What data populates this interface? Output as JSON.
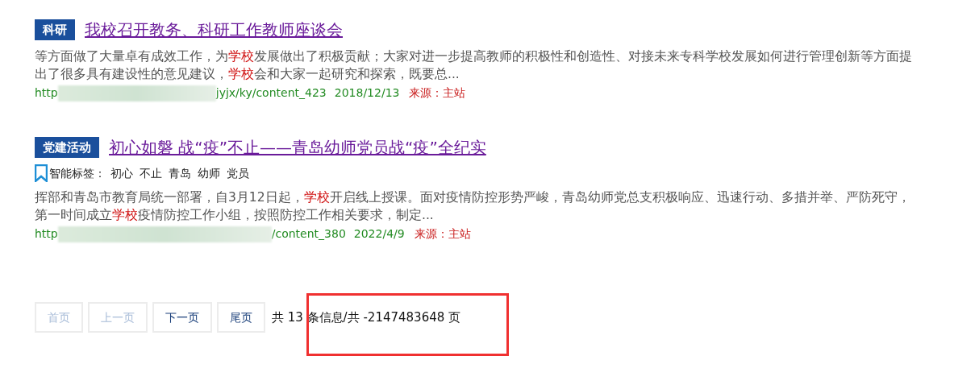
{
  "results": [
    {
      "category": "科研",
      "title": "我校召开教务、科研工作教师座谈会",
      "snippet": [
        {
          "text": "等方面做了大量卓有成效工作，为",
          "highlight": false
        },
        {
          "text": "学校",
          "highlight": true
        },
        {
          "text": "发展做出了积极贡献；大家对进一步提高教师的积极性和创造性、对接未来专科学校发展如何进行管理创新等方面提出了很多具有建设性的意见建议，",
          "highlight": false
        },
        {
          "text": "学校",
          "highlight": true
        },
        {
          "text": "会和大家一起研究和探索，既要总...",
          "highlight": false
        }
      ],
      "url_start": "http",
      "url_end": "jyjx/ky/content_423",
      "date": "2018/12/13",
      "source": "来源：主站"
    },
    {
      "category": "党建活动",
      "title": "初心如磐 战“疫”不止——青岛幼师党员战“疫”全纪实",
      "tags": {
        "label": "智能标签：",
        "items": [
          "初心",
          "不止",
          "青岛",
          "幼师",
          "党员"
        ]
      },
      "snippet": [
        {
          "text": "挥部和青岛市教育局统一部署，自3月12日起，",
          "highlight": false
        },
        {
          "text": "学校",
          "highlight": true
        },
        {
          "text": "开启线上授课。面对疫情防控形势严峻，青岛幼师党总支积极响应、迅速行动、多措并举、严防死守，第一时间成立",
          "highlight": false
        },
        {
          "text": "学校",
          "highlight": true
        },
        {
          "text": "疫情防控工作小组，按照防控工作相关要求，制定...",
          "highlight": false
        }
      ],
      "url_start": "http",
      "url_end": "/content_380",
      "date": "2022/4/9",
      "source": "来源：主站"
    }
  ],
  "pagination": {
    "buttons": [
      {
        "label": "首页",
        "disabled": true
      },
      {
        "label": "上一页",
        "disabled": true
      },
      {
        "label": "下一页",
        "disabled": false
      },
      {
        "label": "尾页",
        "disabled": false
      }
    ],
    "summary": "共 13 条信息/共 -2147483648 页"
  }
}
